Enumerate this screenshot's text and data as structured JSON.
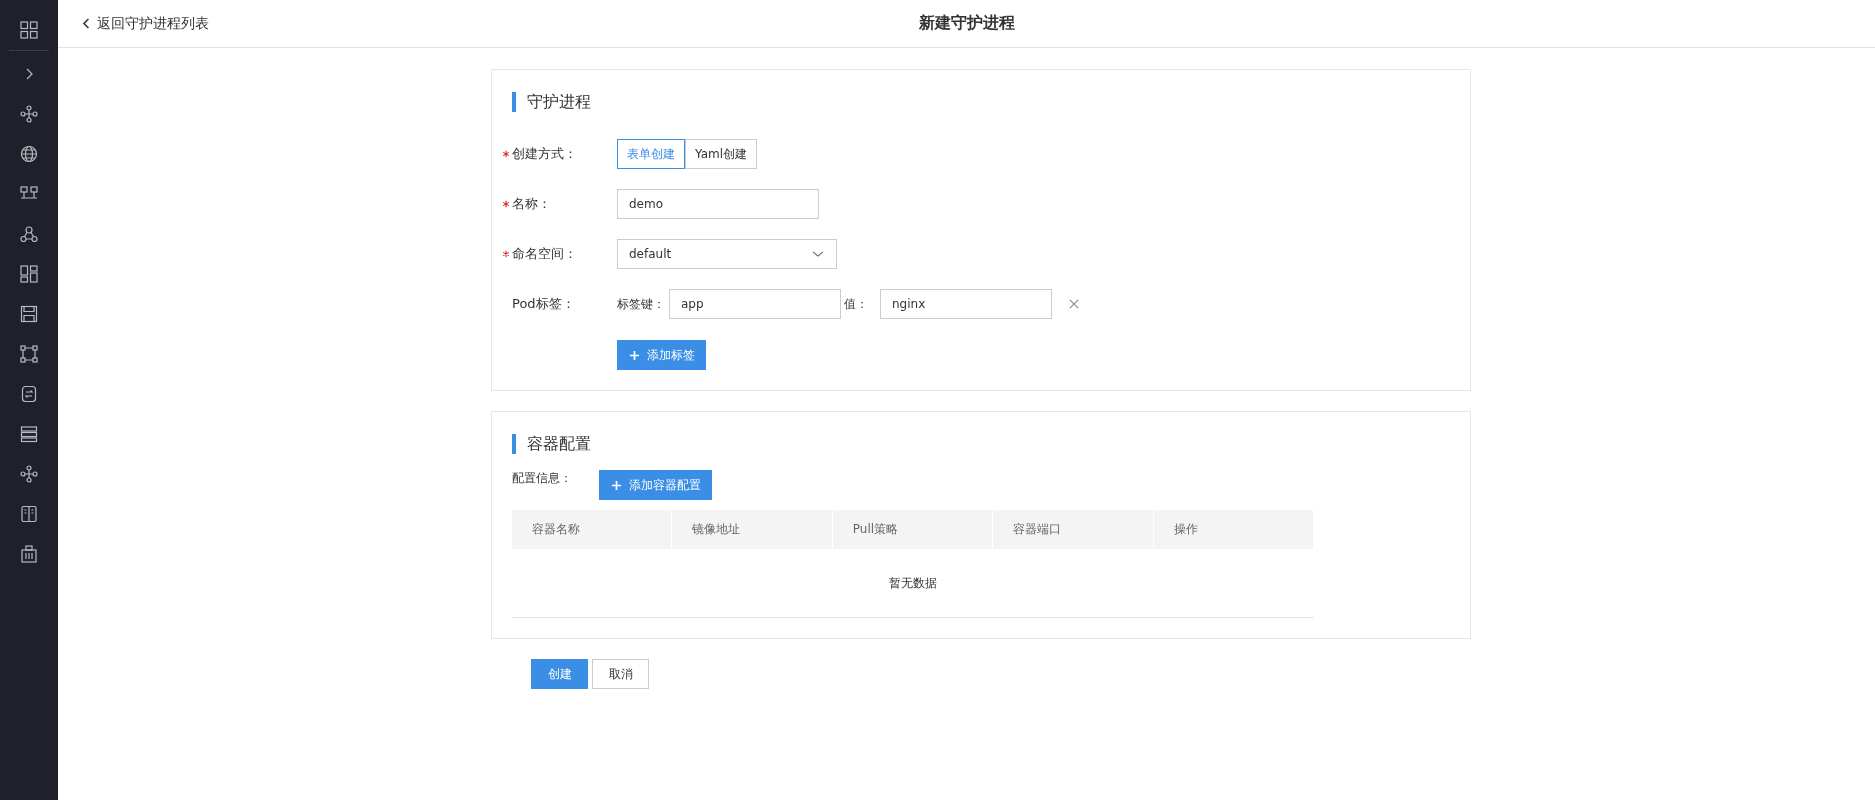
{
  "header": {
    "back_link": "返回守护进程列表",
    "title": "新建守护进程"
  },
  "sections": [
    {
      "title": "守护进程",
      "fields": [
        {
          "kind": "toggle",
          "label": "创建方式：",
          "required": true,
          "options": [
            {
              "label": "表单创建",
              "selected": true
            },
            {
              "label": "Yaml创建",
              "selected": false
            }
          ]
        },
        {
          "kind": "input",
          "label": "名称：",
          "required": true,
          "value": "demo"
        },
        {
          "kind": "select",
          "label": "命名空间：",
          "required": true,
          "value": "default"
        },
        {
          "kind": "labels",
          "label": "Pod标签：",
          "required": false,
          "pairs": [
            {
              "key_label": "标签键：",
              "key": "app",
              "value_label": "值：",
              "value": "nginx"
            }
          ],
          "add_button": "添加标签"
        }
      ]
    },
    {
      "title": "容器配置",
      "config": {
        "label": "配置信息：",
        "add_button": "添加容器配置",
        "table": {
          "columns": [
            "容器名称",
            "镜像地址",
            "Pull策略",
            "容器端口",
            "操作"
          ],
          "empty_text": "暂无数据"
        }
      }
    }
  ],
  "actions": [
    {
      "label": "创建",
      "primary": true
    },
    {
      "label": "取消",
      "primary": false
    }
  ]
}
